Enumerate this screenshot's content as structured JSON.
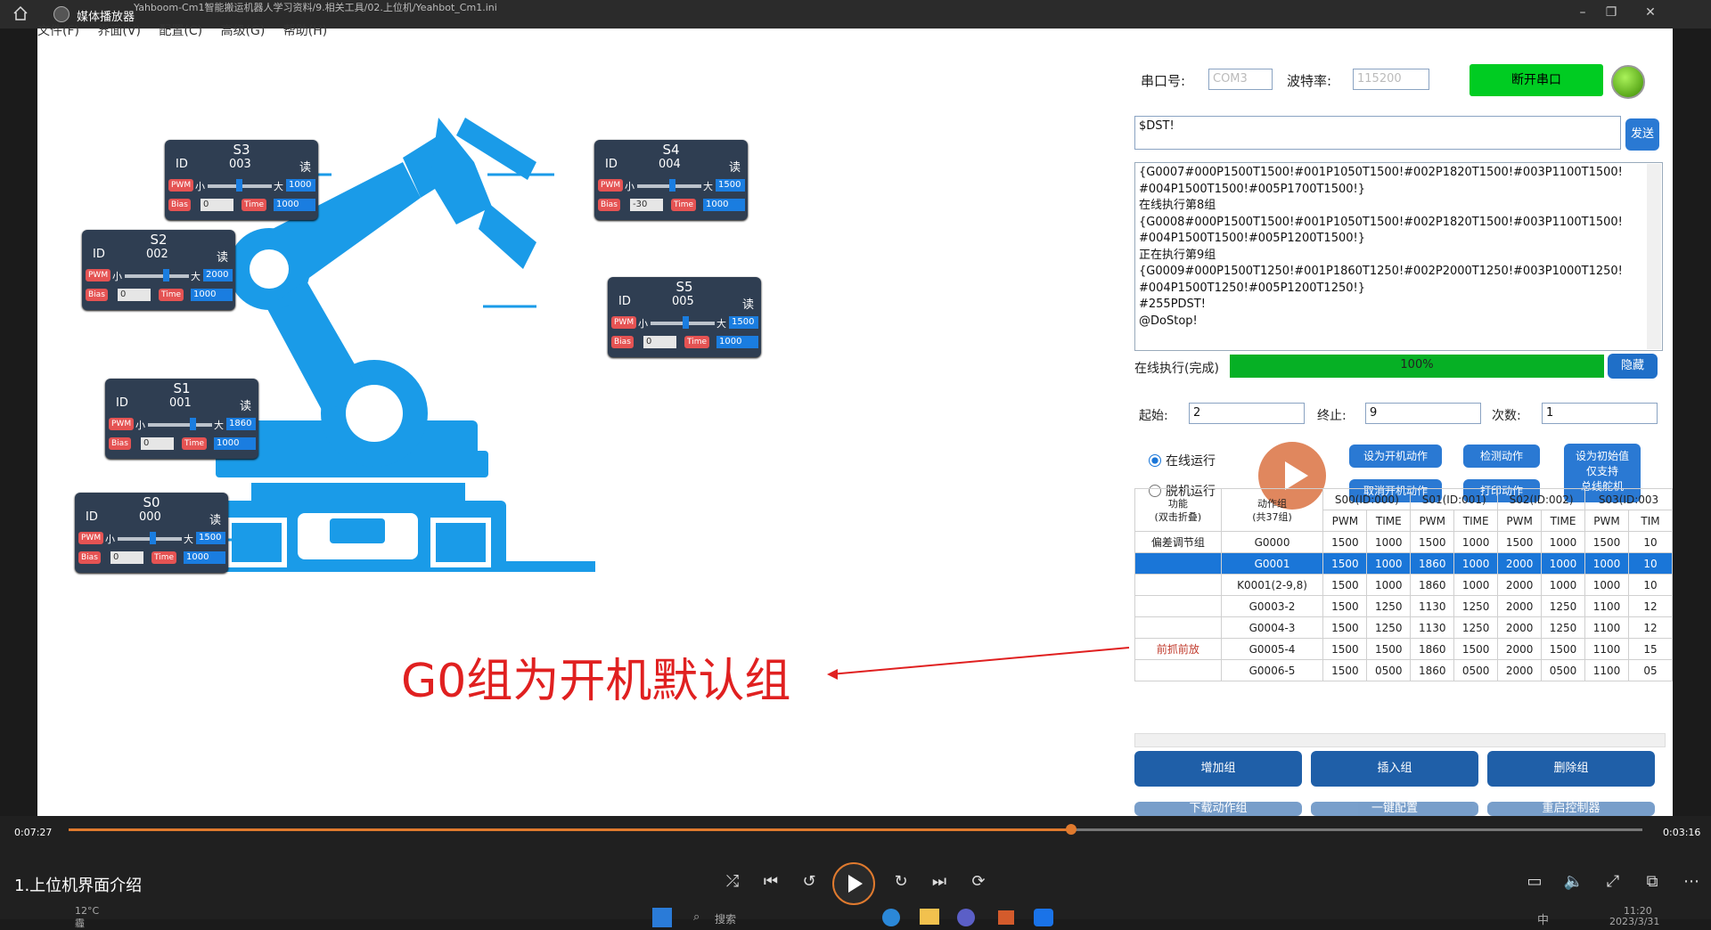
{
  "player": {
    "title": "媒体播放器",
    "path": "Yahboom-Cm1智能搬运机器人学习资料/9.相关工具/02.上位机/Yeahbot_Cm1.ini",
    "time_current": "0:07:27",
    "time_remaining": "0:03:16",
    "progress": 0.637,
    "video_title": "1.上位机界面介绍"
  },
  "menu": [
    "文件(F)",
    "界面(V)",
    "配置(C)",
    "高级(G)",
    "帮助(H)"
  ],
  "servos": [
    {
      "title": "S3",
      "id_label": "ID",
      "id": "003",
      "read": "读",
      "pwm": "PWM",
      "min": "小",
      "max": "大",
      "value": "1000",
      "bias": "Bias",
      "bias_val": "0",
      "time": "Time",
      "time_val": "1000"
    },
    {
      "title": "S4",
      "id_label": "ID",
      "id": "004",
      "read": "读",
      "pwm": "PWM",
      "min": "小",
      "max": "大",
      "value": "1500",
      "bias": "Bias",
      "bias_val": "-30",
      "time": "Time",
      "time_val": "1000"
    },
    {
      "title": "S2",
      "id_label": "ID",
      "id": "002",
      "read": "读",
      "pwm": "PWM",
      "min": "小",
      "max": "大",
      "value": "2000",
      "bias": "Bias",
      "bias_val": "0",
      "time": "Time",
      "time_val": "1000"
    },
    {
      "title": "S5",
      "id_label": "ID",
      "id": "005",
      "read": "读",
      "pwm": "PWM",
      "min": "小",
      "max": "大",
      "value": "1500",
      "bias": "Bias",
      "bias_val": "0",
      "time": "Time",
      "time_val": "1000"
    },
    {
      "title": "S1",
      "id_label": "ID",
      "id": "001",
      "read": "读",
      "pwm": "PWM",
      "min": "小",
      "max": "大",
      "value": "1860",
      "bias": "Bias",
      "bias_val": "0",
      "time": "Time",
      "time_val": "1000"
    },
    {
      "title": "S0",
      "id_label": "ID",
      "id": "000",
      "read": "读",
      "pwm": "PWM",
      "min": "小",
      "max": "大",
      "value": "1500",
      "bias": "Bias",
      "bias_val": "0",
      "time": "Time",
      "time_val": "1000"
    }
  ],
  "annotation": "G0组为开机默认组",
  "serial": {
    "port_label": "串口号:",
    "port_value": "COM3",
    "baud_label": "波特率:",
    "baud_value": "115200",
    "disconnect": "断开串口"
  },
  "command": {
    "value": "$DST!",
    "send": "发送"
  },
  "log": [
    "{G0007#000P1500T1500!#001P1050T1500!#002P1820T1500!#003P1100T1500!",
    "#004P1500T1500!#005P1700T1500!}",
    "在线执行第8组",
    "{G0008#000P1500T1500!#001P1050T1500!#002P1820T1500!#003P1100T1500!",
    "#004P1500T1500!#005P1200T1500!}",
    "正在执行第9组",
    "{G0009#000P1500T1250!#001P1860T1250!#002P2000T1250!#003P1000T1250!",
    "#004P1500T1250!#005P1200T1250!}",
    "#255PDST!",
    "@DoStop!"
  ],
  "exec": {
    "label": "在线执行(完成)",
    "percent": "100%",
    "hide": "隐藏"
  },
  "range": {
    "start_label": "起始:",
    "start": "2",
    "end_label": "终止:",
    "end": "9",
    "count_label": "次数:",
    "count": "1"
  },
  "mode": {
    "online": "在线运行",
    "offline": "脱机运行"
  },
  "actions": {
    "set_boot": "设为开机动作",
    "cancel_boot": "取消开机动作",
    "check": "检测动作",
    "print": "打印动作",
    "init_l1": "设为初始值",
    "init_l2": "仅支持",
    "init_l3": "总线舵机"
  },
  "table": {
    "h_func": "功能",
    "h_func2": "(双击折叠)",
    "h_group": "动作组",
    "h_group2": "(共37组)",
    "h_servos": [
      "S00(ID:000)",
      "S01(ID:001)",
      "S02(ID:002)",
      "S03(ID:003"
    ],
    "sub": [
      "PWM",
      "TIME",
      "PWM",
      "TIME",
      "PWM",
      "TIME",
      "PWM",
      "TIM"
    ],
    "rows": [
      {
        "func": "偏差调节组",
        "group": "G0000",
        "cells": [
          "1500",
          "1000",
          "1500",
          "1000",
          "1500",
          "1000",
          "1500",
          "10"
        ]
      },
      {
        "func": "",
        "group": "G0001",
        "cells": [
          "1500",
          "1000",
          "1860",
          "1000",
          "2000",
          "1000",
          "1000",
          "10"
        ],
        "selected": true
      },
      {
        "func": "",
        "group": "K0001(2-9,8)",
        "cells": [
          "1500",
          "1000",
          "1860",
          "1000",
          "2000",
          "1000",
          "1000",
          "10"
        ]
      },
      {
        "func": "",
        "group": "G0003-2",
        "cells": [
          "1500",
          "1250",
          "1130",
          "1250",
          "2000",
          "1250",
          "1100",
          "12"
        ]
      },
      {
        "func": "",
        "group": "G0004-3",
        "cells": [
          "1500",
          "1250",
          "1130",
          "1250",
          "2000",
          "1250",
          "1100",
          "12"
        ]
      },
      {
        "func": "前抓前放",
        "group": "G0005-4",
        "cells": [
          "1500",
          "1500",
          "1860",
          "1500",
          "2000",
          "1500",
          "1100",
          "15"
        ]
      },
      {
        "func": "",
        "group": "G0006-5",
        "cells": [
          "1500",
          "0500",
          "1860",
          "0500",
          "2000",
          "0500",
          "1100",
          "05"
        ]
      }
    ]
  },
  "group_buttons": {
    "add": "增加组",
    "insert": "插入组",
    "delete": "删除组"
  },
  "hidden_buttons": {
    "download": "下载动作组",
    "one_key": "一键配置",
    "restart": "重启控制器"
  },
  "taskbar": {
    "temp": "12°C",
    "weather": "霾",
    "search": "搜索",
    "ime": "中",
    "clock": "11:20",
    "date": "2023/3/31"
  },
  "colors": {
    "accent_blue": "#1a7de0",
    "dark_panel": "#2f3e52",
    "green": "#00cc22",
    "play_orange": "#e0875e",
    "red": "#e02020"
  }
}
